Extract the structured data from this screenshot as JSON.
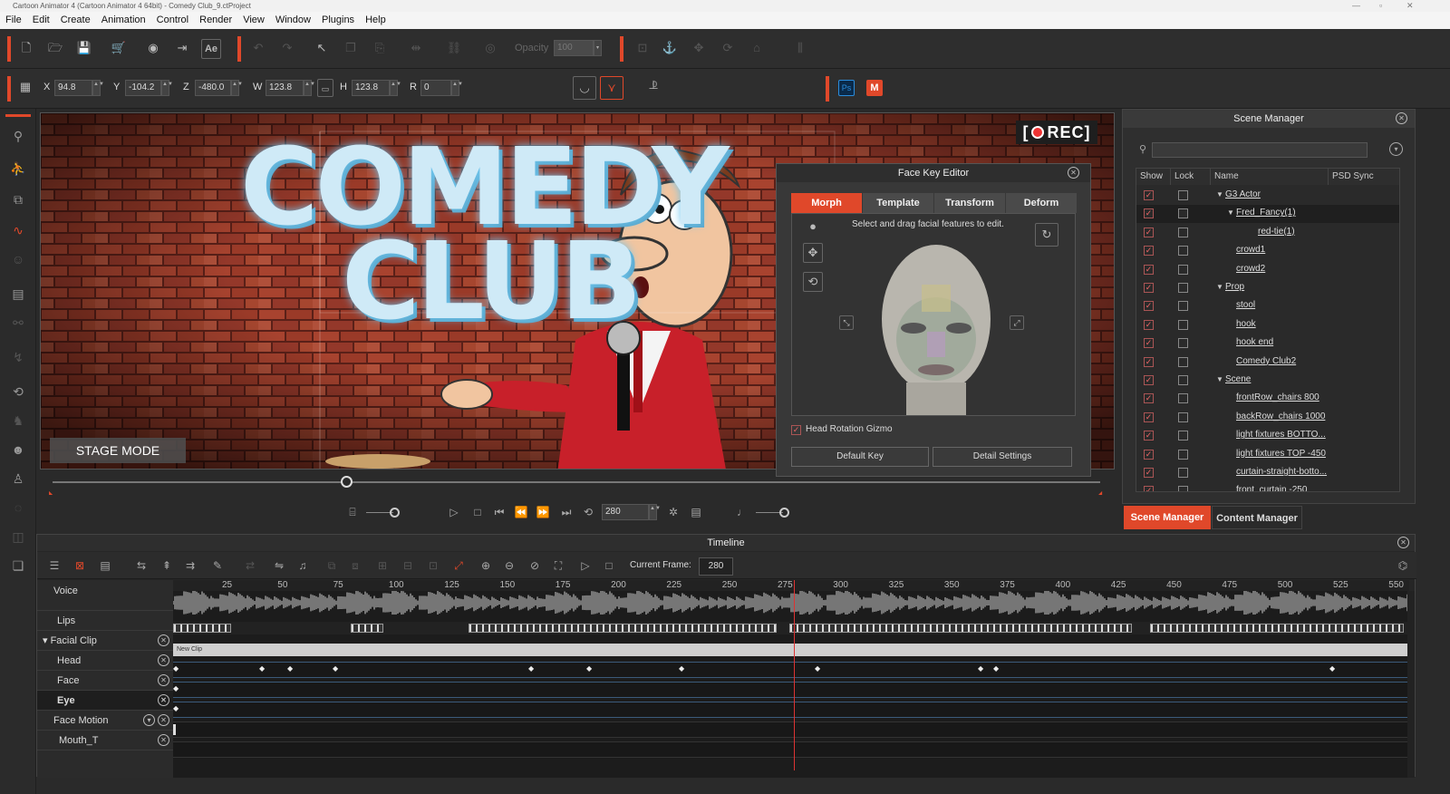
{
  "titlebar": {
    "text": "Cartoon Animator 4  (Cartoon Animator 4 64bit) - Comedy Club_9.ctProject"
  },
  "menu": [
    "File",
    "Edit",
    "Create",
    "Animation",
    "Control",
    "Render",
    "View",
    "Window",
    "Plugins",
    "Help"
  ],
  "toolbar": {
    "opacity_label": "Opacity",
    "opacity_value": "100"
  },
  "transform": {
    "x_label": "X",
    "x": "94.8",
    "y_label": "Y",
    "y": "-104.2",
    "z_label": "Z",
    "z": "-480.0",
    "w_label": "W",
    "w": "123.8",
    "h_label": "H",
    "h": "123.8",
    "r_label": "R",
    "r": "0",
    "pivot_label": "0",
    "ps": "Ps",
    "m": "M"
  },
  "stage": {
    "rec": "REC",
    "mode": "STAGE MODE",
    "sign1": "COMEDY",
    "sign2": "CLUB"
  },
  "playback": {
    "frame": "280"
  },
  "face_key_editor": {
    "title": "Face Key Editor",
    "tabs": [
      "Morph",
      "Template",
      "Transform",
      "Deform"
    ],
    "hint": "Select and drag facial features to edit.",
    "head_rotation_gizmo": "Head Rotation Gizmo",
    "default_key": "Default Key",
    "detail_settings": "Detail Settings"
  },
  "scene_manager": {
    "title": "Scene Manager",
    "columns": [
      "Show",
      "Lock",
      "Name",
      "PSD Sync"
    ],
    "rows": [
      {
        "name": "G3 Actor",
        "indent": 0,
        "expand": true
      },
      {
        "name": "Fred_Fancy(1)",
        "indent": 1,
        "expand": true,
        "selected": true
      },
      {
        "name": "red-tie(1)",
        "indent": 2
      },
      {
        "name": "crowd1",
        "indent": 1
      },
      {
        "name": "crowd2",
        "indent": 1
      },
      {
        "name": "Prop",
        "indent": 0,
        "expand": true
      },
      {
        "name": "stool",
        "indent": 1
      },
      {
        "name": "hook",
        "indent": 1
      },
      {
        "name": "hook end",
        "indent": 1
      },
      {
        "name": "Comedy Club2",
        "indent": 1
      },
      {
        "name": "Scene",
        "indent": 0,
        "expand": true
      },
      {
        "name": "frontRow_chairs 800",
        "indent": 1
      },
      {
        "name": "backRow_chairs 1000",
        "indent": 1
      },
      {
        "name": "light fixtures BOTTO...",
        "indent": 1
      },
      {
        "name": "light fixtures TOP -450",
        "indent": 1
      },
      {
        "name": "curtain-straight-botto...",
        "indent": 1
      },
      {
        "name": "front_curtain -250",
        "indent": 1
      }
    ],
    "tab_scene": "Scene Manager",
    "tab_content": "Content Manager"
  },
  "timeline": {
    "title": "Timeline",
    "current_frame_label": "Current Frame:",
    "current_frame": "280",
    "ruler": [
      "25",
      "50",
      "75",
      "100",
      "125",
      "150",
      "175",
      "200",
      "225",
      "250",
      "275",
      "300",
      "325",
      "350",
      "375",
      "400",
      "425",
      "450",
      "475",
      "500",
      "525",
      "550"
    ],
    "tracks": [
      "Voice",
      "Lips",
      "Facial Clip",
      "Head",
      "Face",
      "Eye",
      "Face Motion",
      "Mouth_T"
    ],
    "clip_label": "New Clip"
  },
  "colors": {
    "accent": "#e0482a",
    "panel": "#2e2e2e"
  }
}
